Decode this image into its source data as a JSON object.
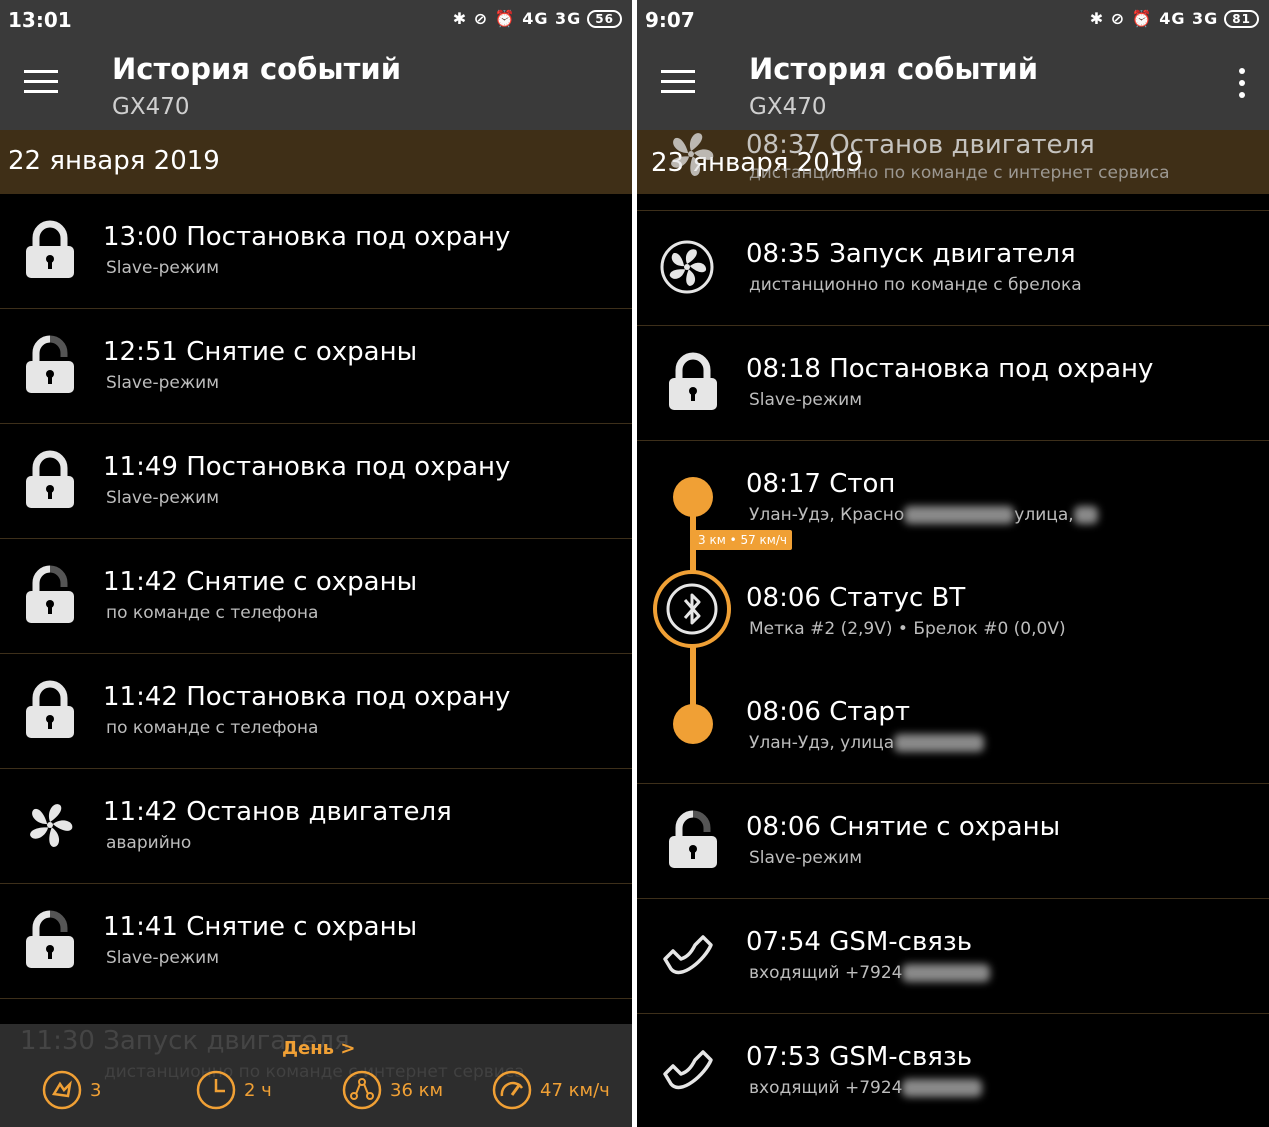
{
  "left": {
    "status": {
      "time": "13:01",
      "icons": "✱ ⊘ ⏰ 4G 3G",
      "battery": "56"
    },
    "appbar": {
      "title": "История событий",
      "subtitle": "GX470"
    },
    "date": "22 января 2019",
    "events": [
      {
        "icon": "lock-icon",
        "title": "13:00 Постановка под охрану",
        "sub": "Slave-режим"
      },
      {
        "icon": "unlock-icon",
        "title": "12:51 Снятие с охраны",
        "sub": "Slave-режим"
      },
      {
        "icon": "lock-icon",
        "title": "11:49 Постановка под охрану",
        "sub": "Slave-режим"
      },
      {
        "icon": "unlock-icon",
        "title": "11:42 Снятие с охраны",
        "sub": "по команде с телефона"
      },
      {
        "icon": "lock-icon",
        "title": "11:42 Постановка под охрану",
        "sub": "по команде с телефона"
      },
      {
        "icon": "fan-icon",
        "title": "11:42 Останов двигателя",
        "sub": "аварийно"
      },
      {
        "icon": "unlock-icon",
        "title": "11:41 Снятие с охраны",
        "sub": "Slave-режим"
      }
    ],
    "ghost_title": "11:30 Запуск двигателя",
    "ghost_sub": "дистанционно по команде с интернет сервиса",
    "bottom": {
      "day_link": "День >",
      "alarms": "3",
      "hours": "2 ч",
      "distance": "36 км",
      "speed": "47 км/ч"
    }
  },
  "right": {
    "status": {
      "time": "9:07",
      "icons": "✱ ⊘ ⏰ 4G 3G",
      "battery": "81"
    },
    "appbar": {
      "title": "История событий",
      "subtitle": "GX470"
    },
    "date": "23 января 2019",
    "overlap_title": "08:37 Останов двигателя",
    "overlap_sub": "дистанционно по команде с интернет сервиса",
    "events": [
      {
        "icon": "fan-icon",
        "title": "08:35 Запуск двигателя",
        "sub": "дистанционно по команде с брелока"
      },
      {
        "icon": "lock-icon",
        "title": "08:18 Постановка под охрану",
        "sub": "Slave-режим"
      },
      {
        "icon": "stop-dot-icon",
        "title": "08:17 Стоп",
        "sub": "Улан-Удэ, Красно",
        "sub2": "улица,"
      },
      {
        "icon": "bluetooth-icon",
        "title": "08:06 Статус BT",
        "sub": "Метка #2 (2,9V)  •  Брелок #0 (0,0V)"
      },
      {
        "icon": "start-dot-icon",
        "title": "08:06 Старт",
        "sub": "Улан-Удэ, улица"
      },
      {
        "icon": "unlock-icon",
        "title": "08:06 Снятие с охраны",
        "sub": "Slave-режим"
      },
      {
        "icon": "phone-icon",
        "title": "07:54 GSM-связь",
        "sub": "входящий +7924"
      },
      {
        "icon": "phone-icon",
        "title": "07:53 GSM-связь",
        "sub": "входящий +7924"
      }
    ],
    "trip_badge": "3 км • 57 км/ч"
  },
  "colors": {
    "accent": "#f0a035",
    "band": "#3f2f17",
    "appbar": "#3a3a3a",
    "icon": "#e6e6e6"
  }
}
